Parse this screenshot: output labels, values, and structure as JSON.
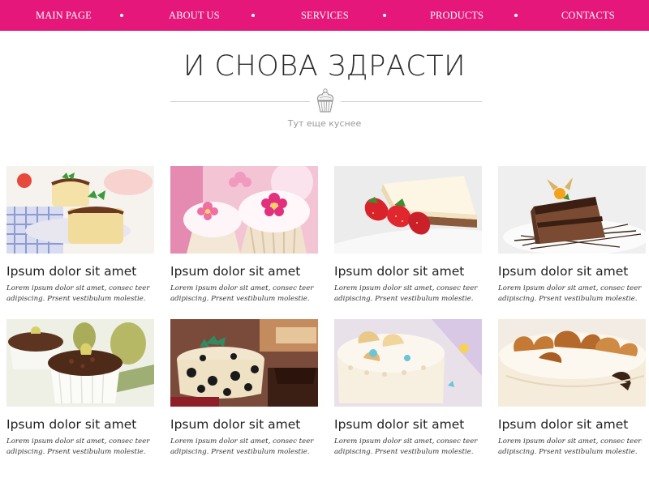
{
  "nav": {
    "items": [
      {
        "label": "MAIN PAGE"
      },
      {
        "label": "ABOUT US"
      },
      {
        "label": "SERVICES"
      },
      {
        "label": "PRODUCTS"
      },
      {
        "label": "CONTACTS"
      }
    ]
  },
  "header": {
    "title": "И СНОВА ЗДРАСТИ",
    "subtitle": "Тут еще куснее",
    "divider_icon": "cupcake-icon"
  },
  "colors": {
    "accent": "#e5177a"
  },
  "cards": [
    {
      "image": "cheesecake-with-mint",
      "title": "Ipsum dolor sit amet",
      "text": "Lorem ipsum dolor sit amet, consec teer adipiscing. Prsent vestibulum molestie."
    },
    {
      "image": "pink-flower-cupcakes",
      "title": "Ipsum dolor sit amet",
      "text": "Lorem ipsum dolor sit amet, consec teer adipiscing. Prsent vestibulum molestie."
    },
    {
      "image": "strawberry-cake-slice",
      "title": "Ipsum dolor sit amet",
      "text": "Lorem ipsum dolor sit amet, consec teer adipiscing. Prsent vestibulum molestie."
    },
    {
      "image": "chocolate-cake-slice",
      "title": "Ipsum dolor sit amet",
      "text": "Lorem ipsum dolor sit amet, consec teer adipiscing. Prsent vestibulum molestie."
    },
    {
      "image": "chocolate-souffle-with-pears",
      "title": "Ipsum dolor sit amet",
      "text": "Lorem ipsum dolor sit amet, consec teer adipiscing. Prsent vestibulum molestie."
    },
    {
      "image": "polka-dot-cake",
      "title": "Ipsum dolor sit amet",
      "text": "Lorem ipsum dolor sit amet, consec teer adipiscing. Prsent vestibulum molestie."
    },
    {
      "image": "white-seashell-cake",
      "title": "Ipsum dolor sit amet",
      "text": "Lorem ipsum dolor sit amet, consec teer adipiscing. Prsent vestibulum molestie."
    },
    {
      "image": "caramel-swirl-cake",
      "title": "Ipsum dolor sit amet",
      "text": "Lorem ipsum dolor sit amet, consec teer adipiscing. Prsent vestibulum molestie."
    }
  ]
}
